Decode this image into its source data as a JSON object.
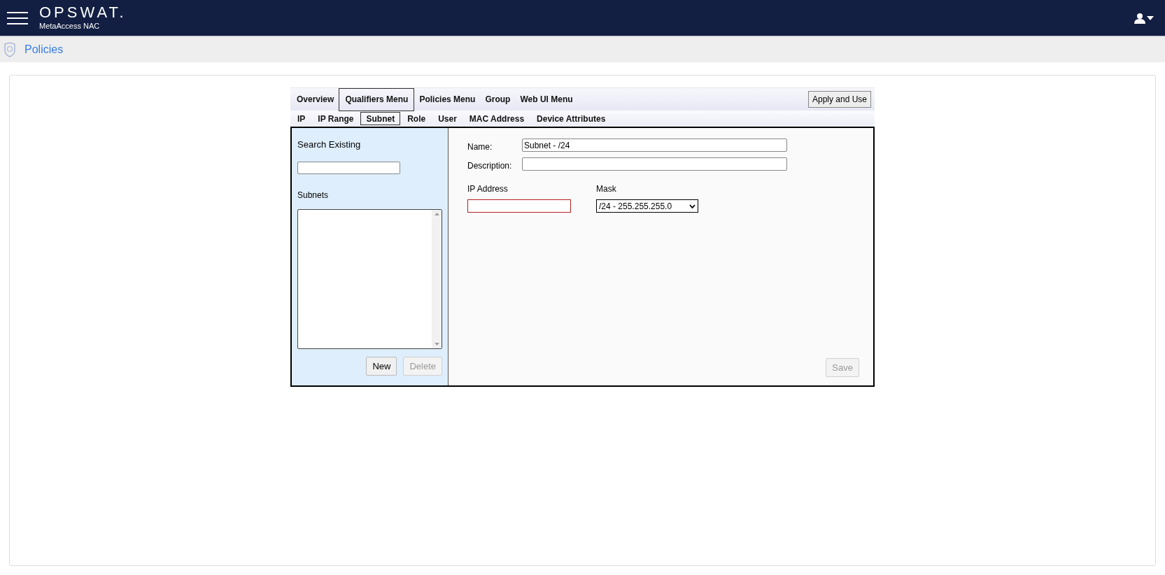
{
  "header": {
    "logo": "OPSWAT.",
    "product": "MetaAccess NAC"
  },
  "breadcrumb": {
    "title": "Policies"
  },
  "menu": [
    {
      "label": "Overview",
      "selected": false
    },
    {
      "label": "Qualifiers Menu",
      "selected": true
    },
    {
      "label": "Policies Menu",
      "selected": false
    },
    {
      "label": "Group",
      "selected": false
    },
    {
      "label": "Web UI Menu",
      "selected": false
    }
  ],
  "apply_button": "Apply and Use",
  "submenu": [
    {
      "label": "IP",
      "selected": false
    },
    {
      "label": "IP Range",
      "selected": false
    },
    {
      "label": "Subnet",
      "selected": true
    },
    {
      "label": "Role",
      "selected": false
    },
    {
      "label": "User",
      "selected": false
    },
    {
      "label": "MAC Address",
      "selected": false
    },
    {
      "label": "Device Attributes",
      "selected": false
    }
  ],
  "sidebar": {
    "search_label": "Search Existing",
    "list_label": "Subnets",
    "buttons": [
      {
        "label": "New",
        "disabled": false
      },
      {
        "label": "Delete",
        "disabled": true
      }
    ]
  },
  "form": {
    "name_label": "Name:",
    "name_value": "Subnet - /24",
    "description_label": "Description:",
    "ip_label": "IP Address",
    "ip_invalid": true,
    "mask_label": "Mask",
    "mask_value": "/24 - 255.255.255.0",
    "save": {
      "label": "Save",
      "disabled": true
    }
  }
}
